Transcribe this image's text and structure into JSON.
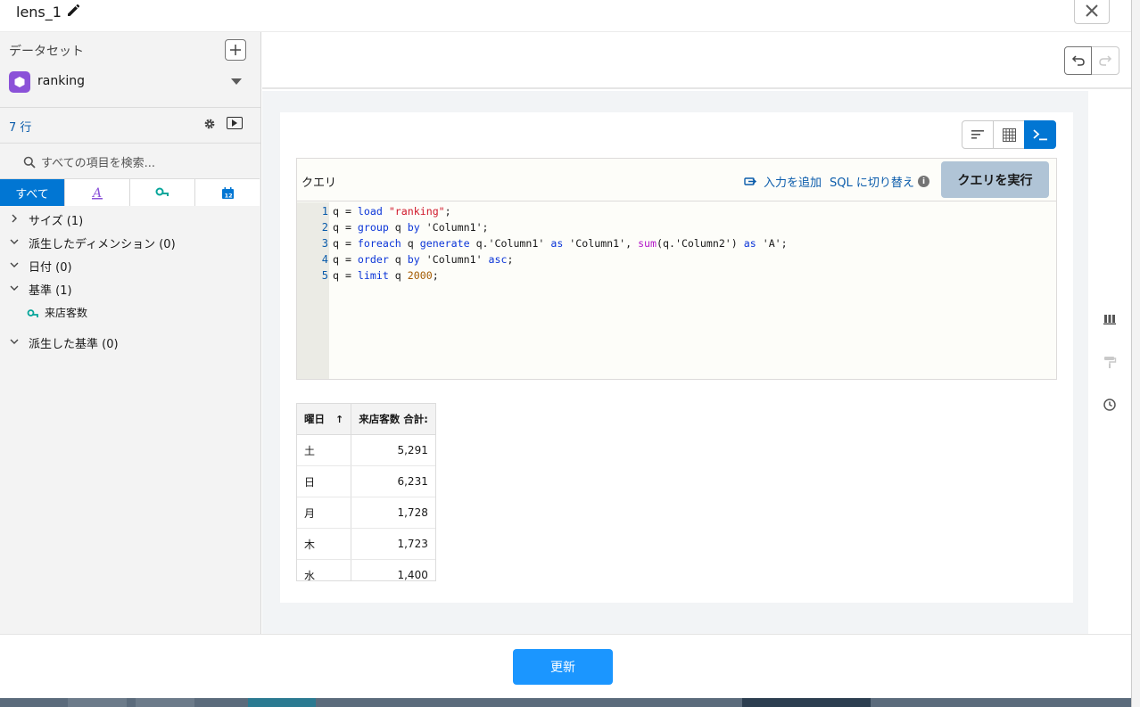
{
  "header": {
    "title": "lens_1"
  },
  "sidebar": {
    "dataset_label": "データセット",
    "dataset_name": "ranking",
    "row_count": "7 行",
    "search_placeholder": "すべての項目を検索...",
    "tabs": [
      {
        "label": "すべて",
        "icon": "all"
      },
      {
        "label": "",
        "icon": "text-dimension-icon"
      },
      {
        "label": "",
        "icon": "measure-icon"
      },
      {
        "label": "",
        "icon": "calendar-icon"
      }
    ],
    "tree": [
      {
        "label": "サイズ (1)",
        "expanded": false
      },
      {
        "label": "派生したディメンション (0)",
        "expanded": true
      },
      {
        "label": "日付 (0)",
        "expanded": true
      },
      {
        "label": "基準 (1)",
        "expanded": true,
        "children": [
          "来店客数"
        ]
      },
      {
        "label": "派生した基準 (0)",
        "expanded": true
      }
    ]
  },
  "editor": {
    "label": "クエリ",
    "add_input": "入力を追加",
    "sql_switch": "SQL に切り替え",
    "run_button": "クエリを実行",
    "line_numbers": [
      "1",
      "2",
      "3",
      "4",
      "5"
    ],
    "code": [
      "q = load \"ranking\";",
      "q = group q by 'Column1';",
      "q = foreach q generate q.'Column1' as 'Column1', sum(q.'Column2') as 'A';",
      "q = order q by 'Column1' asc;",
      "q = limit q 2000;"
    ]
  },
  "table": {
    "headers": [
      "曜日",
      "来店客数 合計:"
    ],
    "sort_indicator": "↑",
    "rows": [
      [
        "土",
        "5,291"
      ],
      [
        "日",
        "6,231"
      ],
      [
        "月",
        "1,728"
      ],
      [
        "木",
        "1,723"
      ],
      [
        "水",
        "1,400"
      ]
    ]
  },
  "footer": {
    "update_button": "更新"
  },
  "colors": {
    "brand": "#0176d3",
    "primary_button": "#1b96ff",
    "dataset_icon": "#8b52d8"
  }
}
